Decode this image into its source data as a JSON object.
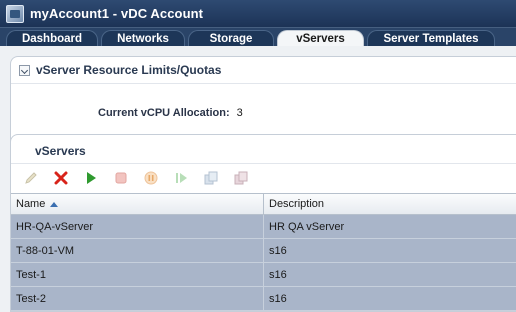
{
  "window": {
    "title": "myAccount1 - vDC Account"
  },
  "tabs": [
    {
      "label": "Dashboard",
      "active": false
    },
    {
      "label": "Networks",
      "active": false
    },
    {
      "label": "Storage",
      "active": false
    },
    {
      "label": "vServers",
      "active": true
    },
    {
      "label": "Server Templates",
      "active": false
    }
  ],
  "quota_panel": {
    "title": "vServer Resource Limits/Quotas",
    "vcpu_label": "Current vCPU Allocation:",
    "vcpu_value": "3"
  },
  "vservers_panel": {
    "title": "vServers",
    "toolbar": [
      {
        "icon": "edit-icon",
        "enabled": false
      },
      {
        "icon": "delete-icon",
        "enabled": true,
        "color": "#d8231a"
      },
      {
        "icon": "start-icon",
        "enabled": true,
        "color": "#2f9a2f"
      },
      {
        "icon": "stop-icon",
        "enabled": false
      },
      {
        "icon": "suspend-icon",
        "enabled": false
      },
      {
        "icon": "resume-icon",
        "enabled": false
      },
      {
        "icon": "clone-icon",
        "enabled": false
      },
      {
        "icon": "snapshot-icon",
        "enabled": false
      }
    ],
    "columns": [
      "Name",
      "Description"
    ],
    "sort": {
      "column": "Name",
      "direction": "ascending"
    },
    "rows": [
      {
        "name": "HR-QA-vServer",
        "description": "HR QA vServer"
      },
      {
        "name": "T-88-01-VM",
        "description": "s16"
      },
      {
        "name": "Test-1",
        "description": "s16"
      },
      {
        "name": "Test-2",
        "description": "s16"
      }
    ]
  },
  "colors": {
    "title_bar": "#1c3356",
    "selected_row": "#a9b5c9",
    "active_tab": "#f4f6f8"
  }
}
